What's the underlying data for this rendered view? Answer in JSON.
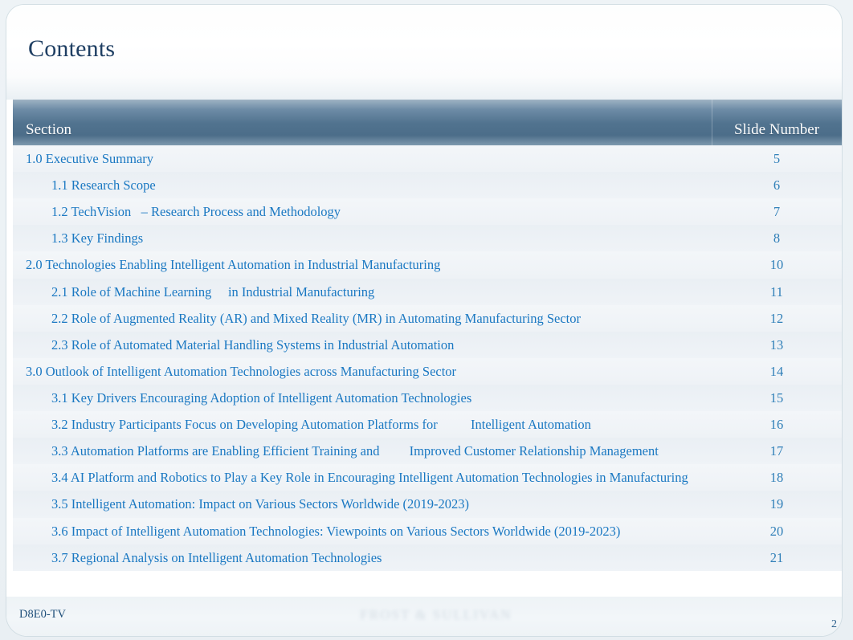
{
  "slide": {
    "title": "Contents",
    "footer_code": "D8E0-TV",
    "page_number": "2",
    "watermark": "FROST & SULLIVAN"
  },
  "table": {
    "headers": {
      "section": "Section",
      "slide_number": "Slide Number"
    },
    "rows": [
      {
        "level": 1,
        "section": "1.0 Executive Summary",
        "slide": "5"
      },
      {
        "level": 2,
        "section": "1.1 Research Scope",
        "slide": "6"
      },
      {
        "level": 2,
        "section": "1.2 TechVision   – Research Process and Methodology",
        "slide": "7"
      },
      {
        "level": 2,
        "section": "1.3 Key Findings",
        "slide": "8"
      },
      {
        "level": 1,
        "section": "2.0 Technologies Enabling Intelligent Automation in Industrial Manufacturing",
        "slide": "10"
      },
      {
        "level": 2,
        "section": "2.1 Role of Machine Learning     in Industrial Manufacturing",
        "slide": "11"
      },
      {
        "level": 2,
        "section": "2.2 Role of Augmented Reality (AR) and Mixed Reality (MR) in Automating Manufacturing Sector",
        "slide": "12"
      },
      {
        "level": 2,
        "section": "2.3 Role of Automated Material Handling Systems in Industrial Automation",
        "slide": "13"
      },
      {
        "level": 1,
        "section": "3.0 Outlook of Intelligent Automation Technologies across Manufacturing Sector",
        "slide": "14"
      },
      {
        "level": 2,
        "section": "3.1 Key Drivers Encouraging Adoption of Intelligent Automation Technologies",
        "slide": "15"
      },
      {
        "level": 2,
        "section": "3.2 Industry Participants Focus on Developing Automation Platforms for          Intelligent Automation",
        "slide": "16"
      },
      {
        "level": 2,
        "section": "3.3 Automation Platforms are Enabling Efficient Training and         Improved Customer Relationship Management",
        "slide": "17"
      },
      {
        "level": 2,
        "section": "3.4 AI Platform and Robotics to Play a Key Role in Encouraging Intelligent Automation Technologies in Manufacturing",
        "slide": "18"
      },
      {
        "level": 2,
        "section": "3.5 Intelligent Automation: Impact on Various Sectors Worldwide (2019-2023)",
        "slide": "19"
      },
      {
        "level": 2,
        "section": "3.6 Impact of Intelligent Automation Technologies: Viewpoints on Various Sectors Worldwide (2019-2023)",
        "slide": "20"
      },
      {
        "level": 2,
        "section": "3.7 Regional Analysis on Intelligent Automation Technologies",
        "slide": "21"
      }
    ]
  },
  "colors": {
    "header_bar": "#51738f",
    "link_blue": "#1a78c2",
    "title_navy": "#1f3f63",
    "row_alt": "#eaeff4",
    "row_base": "#f3f6f9"
  }
}
